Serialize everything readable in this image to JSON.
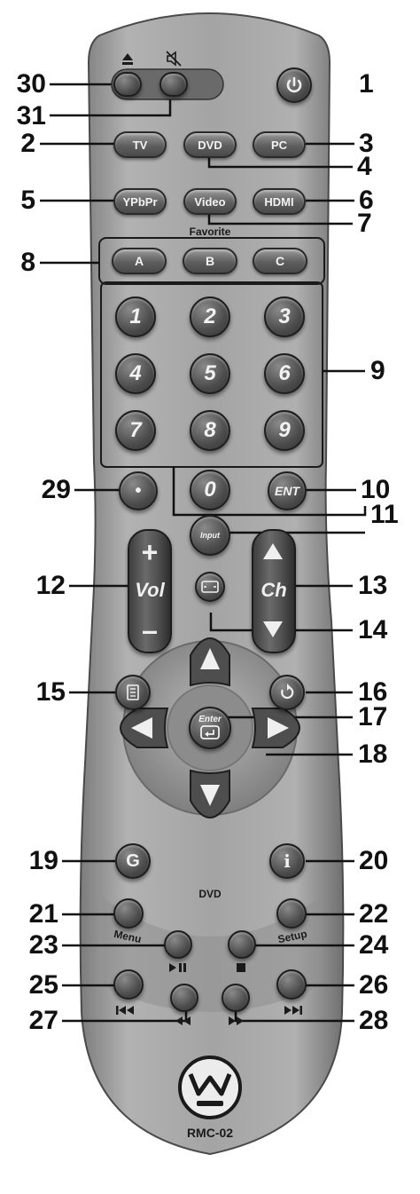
{
  "remote": {
    "model": "RMC-02",
    "favorite_label": "Favorite",
    "dvd_label": "DVD",
    "menu_label": "Menu",
    "setup_label": "Setup",
    "buttons": {
      "tv": "TV",
      "dvd": "DVD",
      "pc": "PC",
      "ypbpr": "YPbPr",
      "video": "Video",
      "hdmi": "HDMI",
      "fav_a": "A",
      "fav_b": "B",
      "fav_c": "C",
      "digits": [
        "1",
        "2",
        "3",
        "4",
        "5",
        "6",
        "7",
        "8",
        "9",
        "0"
      ],
      "dot": "•",
      "ent": "ENT",
      "input": "Input",
      "vol": "Vol",
      "ch": "Ch",
      "enter": "Enter"
    }
  },
  "callouts": {
    "left": [
      "30",
      "31",
      "2",
      "5",
      "8",
      "29",
      "12",
      "15",
      "19",
      "21",
      "23",
      "25",
      "27"
    ],
    "right": [
      "1",
      "3",
      "4",
      "6",
      "7",
      "9",
      "10",
      "11",
      "13",
      "14",
      "16",
      "17",
      "18",
      "20",
      "22",
      "24",
      "26",
      "28"
    ]
  },
  "icons": {
    "eject": "eject-icon",
    "mute": "mute-icon",
    "power": "power-icon",
    "aspect": "aspect-ratio-icon",
    "menu": "menu-icon",
    "return": "return-icon",
    "guide": "guide-icon",
    "info": "info-icon",
    "brand": "westinghouse-logo"
  },
  "colors": {
    "body": "#9c9c9c",
    "button": "#555555",
    "text": "#111111"
  }
}
